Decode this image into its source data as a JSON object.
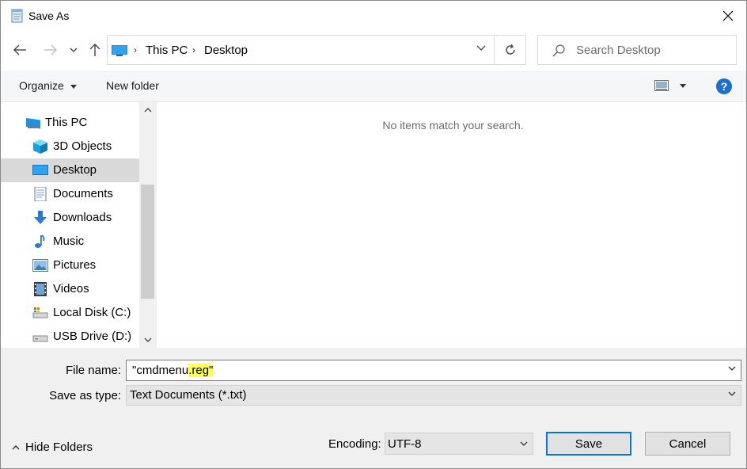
{
  "window": {
    "title": "Save As"
  },
  "address": {
    "crumbs": [
      "This PC",
      "Desktop"
    ]
  },
  "search": {
    "placeholder": "Search Desktop"
  },
  "toolbar": {
    "organize": "Organize",
    "new_folder": "New folder",
    "help": "?"
  },
  "nav": {
    "root": "This PC",
    "items": [
      {
        "label": "3D Objects",
        "icon": "3d-objects-icon"
      },
      {
        "label": "Desktop",
        "icon": "desktop-icon",
        "selected": true
      },
      {
        "label": "Documents",
        "icon": "documents-icon"
      },
      {
        "label": "Downloads",
        "icon": "downloads-icon"
      },
      {
        "label": "Music",
        "icon": "music-icon"
      },
      {
        "label": "Pictures",
        "icon": "pictures-icon"
      },
      {
        "label": "Videos",
        "icon": "videos-icon"
      },
      {
        "label": "Local Disk (C:)",
        "icon": "local-disk-icon"
      },
      {
        "label": "USB Drive (D:)",
        "icon": "usb-drive-icon"
      }
    ]
  },
  "content": {
    "empty_message": "No items match your search."
  },
  "form": {
    "file_name_label": "File name:",
    "file_name_value": "\"cmdmenu.reg\"",
    "file_name_part1": "\"cmdmenu",
    "file_name_part2": ".reg\"",
    "save_type_label": "Save as type:",
    "save_type_value": "Text Documents (*.txt)",
    "encoding_label": "Encoding:",
    "encoding_value": "UTF-8",
    "hide_folders": "Hide Folders",
    "save": "Save",
    "cancel": "Cancel"
  },
  "colors": {
    "accent": "#0078d7",
    "help": "#1a6fd0",
    "selected": "#d9d9d9",
    "highlight": "#ffff4d"
  }
}
